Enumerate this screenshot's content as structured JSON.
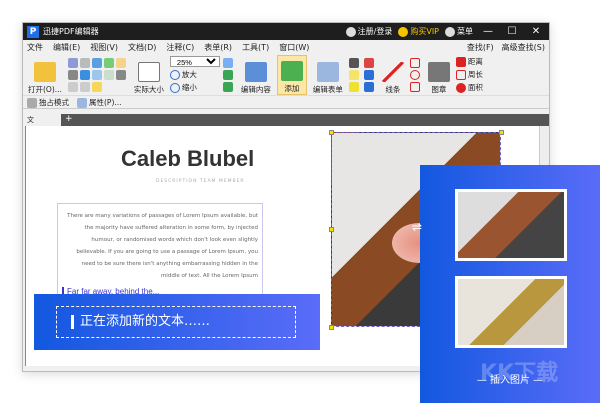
{
  "app": {
    "logo": "P",
    "title": "迅捷PDF编辑器",
    "login": "注册/登录",
    "vip": "购买VIP",
    "menu_label": "菜单",
    "minimize": "—",
    "maximize": "☐",
    "close": "✕"
  },
  "menubar": {
    "items": [
      "文件",
      "编辑(E)",
      "视图(V)",
      "文档(D)",
      "注释(C)",
      "表单(R)",
      "工具(T)",
      "窗口(W)"
    ],
    "find": "查找(F)",
    "advanced_find": "高级查找(S)"
  },
  "toolbar": {
    "open": "打开(O)...",
    "actual_size": "实际大小",
    "zoom_value": "25%",
    "zoom_in": "放大",
    "zoom_out": "缩小",
    "edit_content": "编辑内容",
    "add": "添加",
    "edit_form": "编辑表单",
    "lines": "线条",
    "stamp": "图章",
    "distance": "距离",
    "perimeter": "周长",
    "area": "面积"
  },
  "toolbar2": {
    "exclusive_mode": "独占模式",
    "properties": "属性(P)..."
  },
  "tabs": [
    {
      "label": "文档-1",
      "close": "×"
    }
  ],
  "tab_add": "+",
  "document": {
    "name": "Caleb Blubel",
    "description": "DESCRIPTION TEAM MEMBER",
    "body": "There are many variations of passages of Lorem Ipsum available, but the majority have suffered alteration in some form, by injected humour, or randomised words which don't look even slightly believable. If you are going to use a passage of Lorem Ipsum, you need to be sure there isn't anything embarrassing hidden in the middle of text. All the Lorem Ipsum",
    "typing": "Far far away, behind the..."
  },
  "banner": {
    "text": "正在添加新的文本……"
  },
  "panel": {
    "caption": "— 插入图片 —",
    "swap_icon": "⇌"
  },
  "watermark": "KK下载",
  "colors": {
    "accent": "#1358e0",
    "accent_end": "#5a6cf8",
    "titlebar": "#1e1e1e",
    "vip": "#f5c400"
  }
}
